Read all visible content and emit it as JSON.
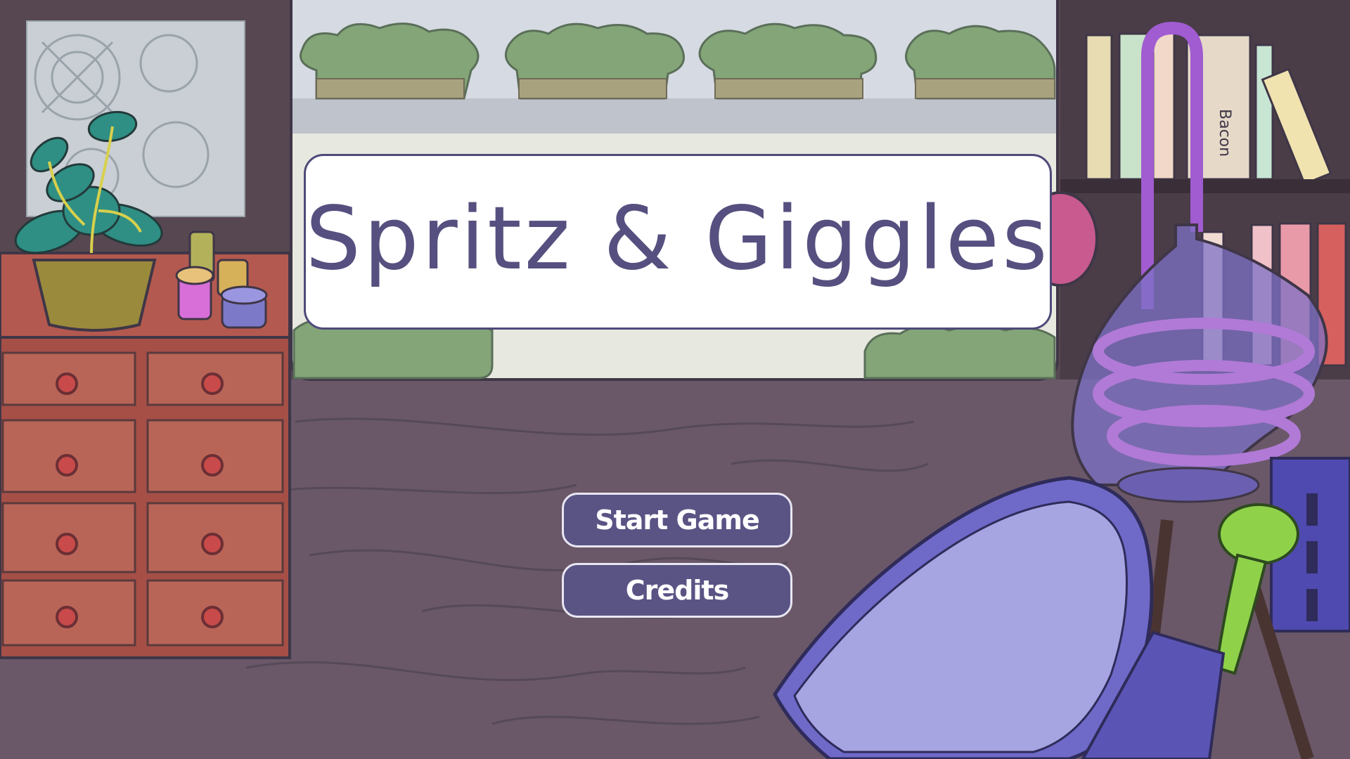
{
  "game": {
    "title": "Spritz & Giggles"
  },
  "menu": {
    "start_label": "Start Game",
    "credits_label": "Credits"
  },
  "scene": {
    "book_label": "Bacon"
  },
  "colors": {
    "floor": "#6a5868",
    "wall": "#564751",
    "title_text": "#55507f",
    "button_fill": "#5a5485",
    "button_border": "#e9e6f3",
    "dresser": "#b4594f",
    "flask_liquid": "#b07ad6"
  }
}
